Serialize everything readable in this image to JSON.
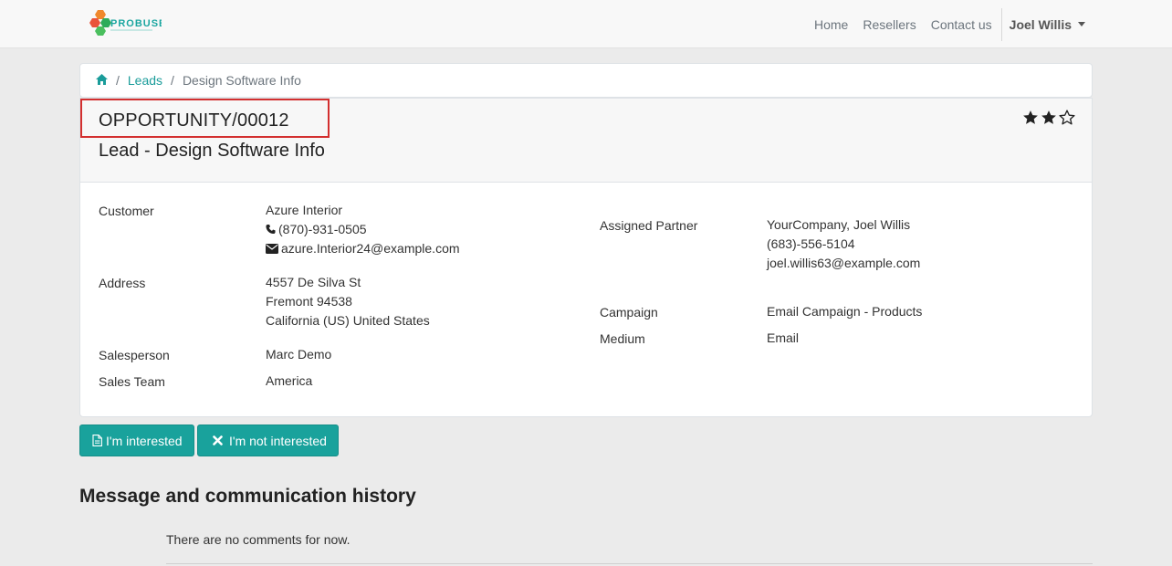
{
  "navbar": {
    "logo_text": "PROBUSE",
    "links": [
      "Home",
      "Resellers",
      "Contact us"
    ],
    "user": "Joel Willis"
  },
  "breadcrumb": {
    "home_icon": "home-icon",
    "leads": "Leads",
    "current": "Design Software Info",
    "sep": "/"
  },
  "header": {
    "reference": "OPPORTUNITY/00012",
    "title": "Lead - Design Software Info",
    "stars_filled": 2,
    "stars_total": 3
  },
  "left": {
    "customer_label": "Customer",
    "customer_name": "Azure Interior",
    "customer_phone": "(870)-931-0505",
    "customer_email": "azure.Interior24@example.com",
    "address_label": "Address",
    "address_line1": "4557 De Silva St",
    "address_line2": "Fremont 94538",
    "address_line3": "California (US) United States",
    "salesperson_label": "Salesperson",
    "salesperson": "Marc Demo",
    "team_label": "Sales Team",
    "team": "America"
  },
  "right": {
    "partner_label": "Assigned Partner",
    "partner_name": "YourCompany, Joel Willis",
    "partner_phone": "(683)-556-5104",
    "partner_email": "joel.willis63@example.com",
    "campaign_label": "Campaign",
    "campaign": "Email Campaign - Products",
    "medium_label": "Medium",
    "medium": "Email"
  },
  "actions": {
    "interested": "I'm interested",
    "not_interested": "I'm not interested"
  },
  "messages": {
    "title": "Message and communication history",
    "empty": "There are no comments for now."
  },
  "colors": {
    "accent": "#19a29c",
    "highlight_border": "#d32f2f",
    "link": "#1a9c9a"
  }
}
